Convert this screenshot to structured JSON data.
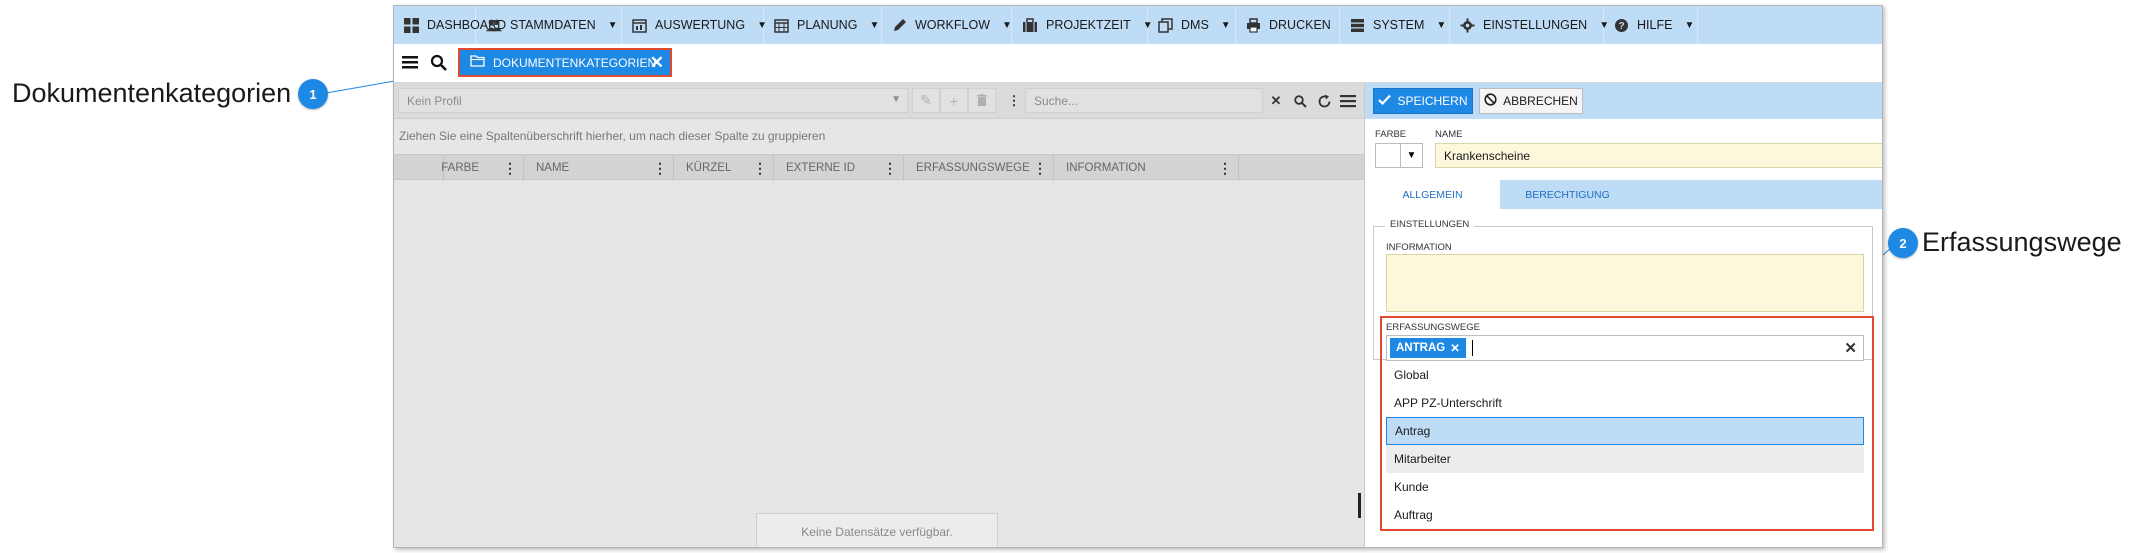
{
  "callouts": [
    {
      "number": "1",
      "label": "Dokumentenkategorien"
    },
    {
      "number": "2",
      "label": "Erfassungswege"
    }
  ],
  "menubar": {
    "items": [
      {
        "label": "DASHBOARD",
        "icon": "grid-icon",
        "has_caret": false
      },
      {
        "label": "STAMMDATEN",
        "icon": "users-icon",
        "has_caret": true
      },
      {
        "label": "AUSWERTUNG",
        "icon": "calendar-chart-icon",
        "has_caret": true
      },
      {
        "label": "PLANUNG",
        "icon": "calendar-icon",
        "has_caret": true
      },
      {
        "label": "WORKFLOW",
        "icon": "pencil-icon",
        "has_caret": true
      },
      {
        "label": "PROJEKTZEIT",
        "icon": "briefcase-icon",
        "has_caret": true
      },
      {
        "label": "DMS",
        "icon": "copy-icon",
        "has_caret": true
      },
      {
        "label": "DRUCKEN",
        "icon": "printer-icon",
        "has_caret": false
      },
      {
        "label": "SYSTEM",
        "icon": "server-icon",
        "has_caret": true
      },
      {
        "label": "EINSTELLUNGEN",
        "icon": "gear-icon",
        "has_caret": true
      },
      {
        "label": "HILFE",
        "icon": "question-icon",
        "has_caret": true
      }
    ]
  },
  "tabs": {
    "active_label": "DOKUMENTENKATEGORIEN"
  },
  "grid": {
    "profile_placeholder": "Kein Profil",
    "search_placeholder": "Suche...",
    "group_hint": "Ziehen Sie eine Spaltenüberschrift hierher, um nach dieser Spalte zu gruppieren",
    "columns": [
      "FARBE",
      "NAME",
      "KÜRZEL",
      "EXTERNE ID",
      "ERFASSUNGSWEGE",
      "INFORMATION"
    ],
    "empty_message": "Keine Datensätze verfügbar."
  },
  "form": {
    "save_label": "SPEICHERN",
    "cancel_label": "ABBRECHEN",
    "color_label": "FARBE",
    "name_label": "NAME",
    "name_value": "Krankenscheine",
    "tabs": [
      "ALLGEMEIN",
      "BERECHTIGUNG"
    ],
    "settings_legend": "EINSTELLUNGEN",
    "info_label": "INFORMATION",
    "erf_label": "ERFASSUNGSWEGE",
    "erf_chip": "ANTRAG",
    "erf_options": [
      "Global",
      "APP PZ-Unterschrift",
      "Antrag",
      "Mitarbeiter",
      "Kunde",
      "Auftrag"
    ],
    "erf_selected_index": 2,
    "erf_hover_index": 3
  },
  "colors": {
    "accent": "#1e88e5",
    "menubar_bg": "#bfdcf7",
    "highlight_border": "#e04a2e",
    "input_yellow": "#fdf8dc"
  }
}
